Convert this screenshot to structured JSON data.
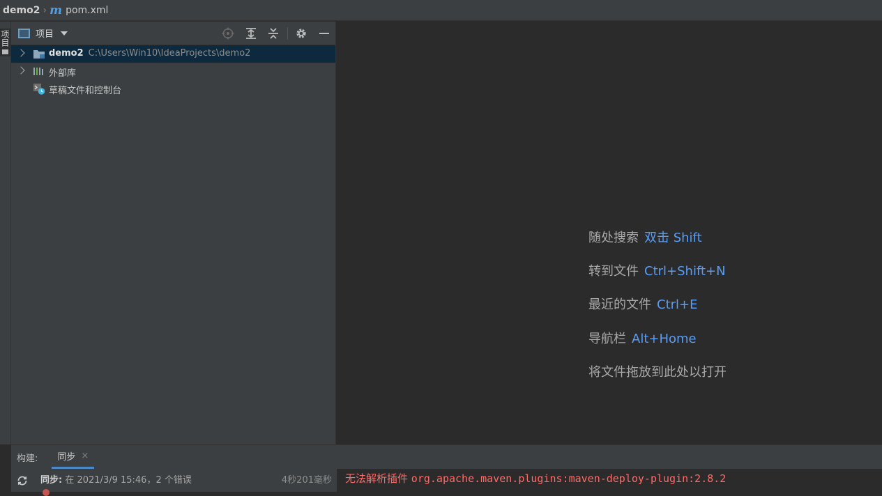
{
  "navbar": {
    "root": "demo2",
    "file_icon": "m",
    "file": "pom.xml"
  },
  "left_strip": {
    "tab_label": "项目"
  },
  "project_panel": {
    "title": "项目",
    "tools": [
      "locate-icon",
      "expand-all-icon",
      "collapse-all-icon",
      "gear-icon",
      "minimize-icon"
    ],
    "tree": [
      {
        "label": "demo2",
        "path": "C:\\Users\\Win10\\IdeaProjects\\demo2",
        "icon": "module-folder-icon",
        "expandable": true,
        "selected": true
      },
      {
        "label": "外部库",
        "icon": "library-icon",
        "expandable": true,
        "selected": false
      },
      {
        "label": "草稿文件和控制台",
        "icon": "scratch-icon",
        "expandable": false,
        "selected": false
      }
    ]
  },
  "editor": {
    "hints": [
      {
        "text": "随处搜索",
        "shortcut": "双击 Shift"
      },
      {
        "text": "转到文件",
        "shortcut": "Ctrl+Shift+N"
      },
      {
        "text": "最近的文件",
        "shortcut": "Ctrl+E"
      },
      {
        "text": "导航栏",
        "shortcut": "Alt+Home"
      },
      {
        "text": "将文件拖放到此处以打开",
        "shortcut": ""
      }
    ]
  },
  "build_panel": {
    "label": "构建:",
    "tab": "同步",
    "close": "×",
    "sync_title": "同步:",
    "sync_detail": "在 2021/3/9 15:46，2 个错误",
    "sync_time": "4秒201毫秒",
    "console_prefix": "无法解析插件",
    "console_plugin": "org.apache.maven.plugins:maven-deploy-plugin:2.8.2"
  },
  "colors": {
    "accent": "#589df6",
    "error": "#ff6b68",
    "selection": "#0d293e",
    "panel_bg": "#3c3f41",
    "editor_bg": "#2b2b2b"
  }
}
